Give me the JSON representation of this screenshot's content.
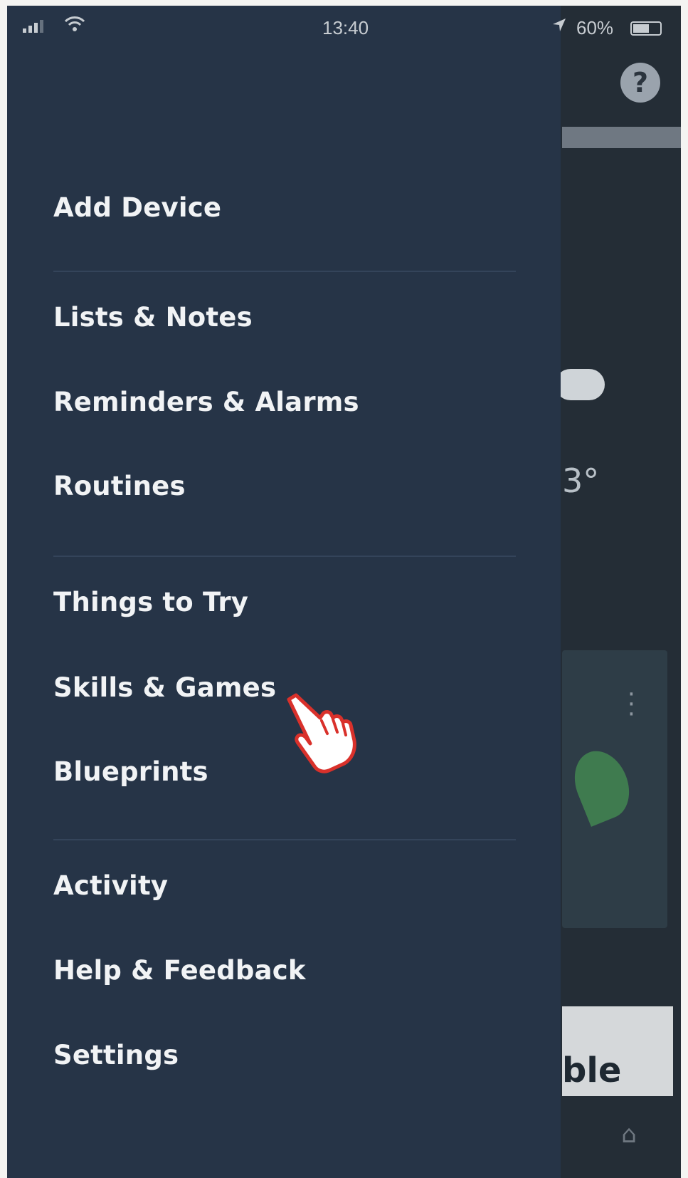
{
  "status_bar": {
    "time": "13:40",
    "battery_percent": "60%",
    "battery_level": 0.6,
    "icons": [
      "signal-icon",
      "wifi-icon",
      "location-arrow-icon",
      "battery-icon"
    ]
  },
  "drawer": {
    "menu": [
      {
        "label": "Add Device"
      },
      {
        "label": "Lists & Notes"
      },
      {
        "label": "Reminders & Alarms"
      },
      {
        "label": "Routines"
      },
      {
        "label": "Things to Try"
      },
      {
        "label": "Skills & Games"
      },
      {
        "label": "Blueprints"
      },
      {
        "label": "Activity"
      },
      {
        "label": "Help & Feedback"
      },
      {
        "label": "Settings"
      }
    ],
    "highlighted_item": "Skills & Games"
  },
  "background_app": {
    "help_icon": "?",
    "temperature_fragment": "3°",
    "button_fragment": "ble"
  },
  "colors": {
    "drawer_background": "#263447",
    "menu_text": "#f1f3f5",
    "cursor_accent": "#d9312b"
  }
}
